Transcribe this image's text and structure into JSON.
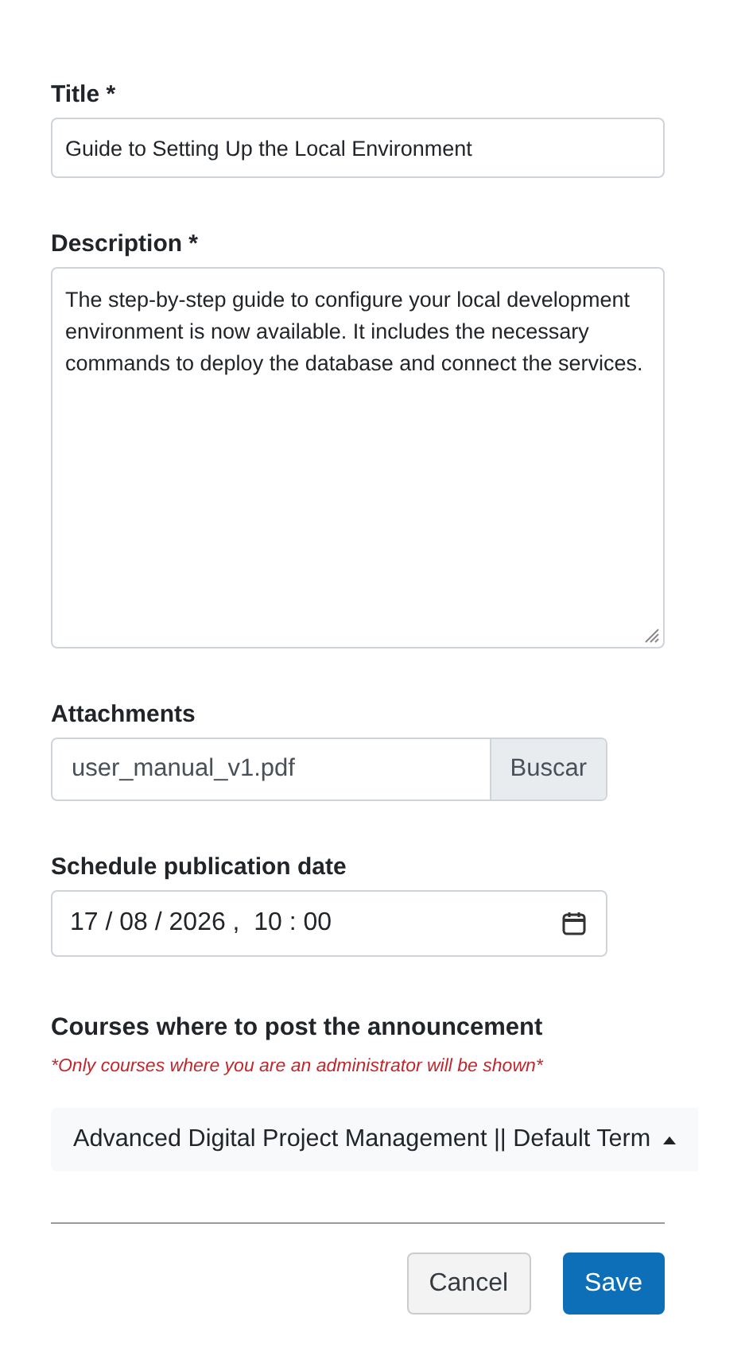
{
  "fields": [
    {
      "kind": "text",
      "label": "Title *",
      "value": "Guide to Setting Up the Local Environment"
    },
    {
      "kind": "textarea",
      "label": "Description *",
      "value": "The step-by-step guide to configure your local development environment is now available. It includes the necessary commands to deploy the database and connect the services."
    },
    {
      "kind": "file",
      "label": "Attachments",
      "value": "user_manual_v1.pdf",
      "button": "Buscar"
    },
    {
      "kind": "datetime",
      "label": "Schedule publication date",
      "value": "17 / 08 / 2026 ,  10 : 00"
    }
  ],
  "courses": {
    "heading": "Courses where to post the announcement",
    "note": "*Only courses where you are an administrator will be shown*",
    "selected_course": "Advanced Digital Project Management || Default Term",
    "expanded": true
  },
  "buttons": [
    {
      "label": "Cancel",
      "kind": "secondary"
    },
    {
      "label": "Save",
      "kind": "primary"
    }
  ]
}
